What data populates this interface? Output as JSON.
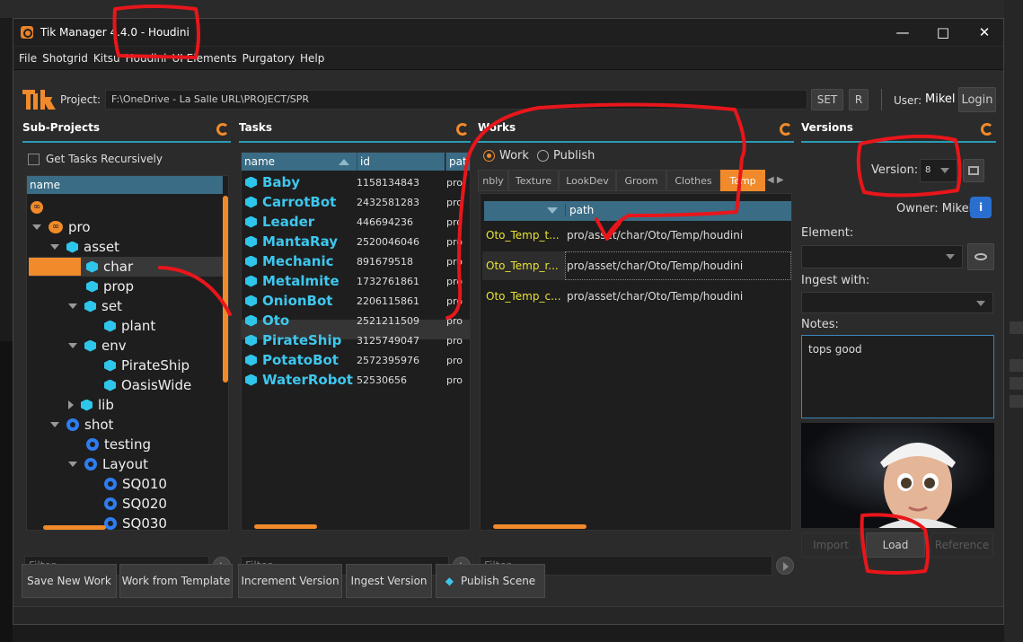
{
  "window": {
    "title": "Tik Manager 4.4.0 - Houdini"
  },
  "menu": [
    "File",
    "Shotgrid",
    "Kitsu",
    "Houdini",
    "UI Elements",
    "Purgatory",
    "Help"
  ],
  "header": {
    "project_label": "Project:",
    "project_path": "F:\\OneDrive - La Salle URL\\PROJECT/SPR",
    "set_label": "SET",
    "r_label": "R",
    "user_label": "User:",
    "user_name": "Mikel",
    "login_label": "Login"
  },
  "subprojects": {
    "title": "Sub-Projects",
    "recursive_label": "Get Tasks Recursively",
    "col_name": "name",
    "filter_placeholder": "Filter",
    "tree": [
      {
        "label": "pro",
        "icon": "infinity"
      },
      {
        "label": "asset",
        "icon": "cube"
      },
      {
        "label": "char",
        "icon": "cube"
      },
      {
        "label": "prop",
        "icon": "cube"
      },
      {
        "label": "set",
        "icon": "cube"
      },
      {
        "label": "plant",
        "icon": "cube"
      },
      {
        "label": "env",
        "icon": "cube"
      },
      {
        "label": "PirateShip",
        "icon": "cube"
      },
      {
        "label": "OasisWide",
        "icon": "cube"
      },
      {
        "label": "lib",
        "icon": "cube"
      },
      {
        "label": "shot",
        "icon": "reel"
      },
      {
        "label": "testing",
        "icon": "reel"
      },
      {
        "label": "Layout",
        "icon": "reel"
      },
      {
        "label": "SQ010",
        "icon": "reel"
      },
      {
        "label": "SQ020",
        "icon": "reel"
      },
      {
        "label": "SQ030",
        "icon": "reel"
      }
    ]
  },
  "tasks": {
    "title": "Tasks",
    "cols": [
      "name",
      "id",
      "pat"
    ],
    "filter_placeholder": "Filter",
    "rows": [
      {
        "name": "Baby",
        "id": "1158134843",
        "path": "pro"
      },
      {
        "name": "CarrotBot",
        "id": "2432581283",
        "path": "pro"
      },
      {
        "name": "Leader",
        "id": "446694236",
        "path": "pro"
      },
      {
        "name": "MantaRay",
        "id": "2520046046",
        "path": "pro"
      },
      {
        "name": "Mechanic",
        "id": "891679518",
        "path": "pro"
      },
      {
        "name": "Metalmite",
        "id": "1732761861",
        "path": "pro"
      },
      {
        "name": "OnionBot",
        "id": "2206115861",
        "path": "pro"
      },
      {
        "name": "Oto",
        "id": "2521211509",
        "path": "pro"
      },
      {
        "name": "PirateShip",
        "id": "3125749047",
        "path": "pro"
      },
      {
        "name": "PotatoBot",
        "id": "2572395976",
        "path": "pro"
      },
      {
        "name": "WaterRobot",
        "id": "52530656",
        "path": "pro"
      }
    ]
  },
  "works": {
    "title": "Works",
    "work_label": "Work",
    "publish_label": "Publish",
    "tabs": [
      "nbly",
      "Texture",
      "LookDev",
      "Groom",
      "Clothes",
      "Temp"
    ],
    "col_path": "path",
    "filter_placeholder": "Filter",
    "rows": [
      {
        "name": "Oto_Temp_t...",
        "path": "pro/asset/char/Oto/Temp/houdini"
      },
      {
        "name": "Oto_Temp_r...",
        "path": "pro/asset/char/Oto/Temp/houdini"
      },
      {
        "name": "Oto_Temp_c...",
        "path": "pro/asset/char/Oto/Temp/houdini"
      }
    ]
  },
  "versions": {
    "title": "Versions",
    "version_label": "Version:",
    "version_value": "8",
    "owner_label": "Owner: Mikel",
    "element_label": "Element:",
    "ingest_label": "Ingest with:",
    "notes_label": "Notes:",
    "notes_text": "tops good",
    "import_label": "Import",
    "load_label": "Load",
    "reference_label": "Reference"
  },
  "actions": {
    "save_new_work": "Save New Work",
    "work_from_template": "Work from Template",
    "increment_version": "Increment Version",
    "ingest_version": "Ingest Version",
    "publish_scene": "Publish Scene"
  },
  "colors": {
    "accent": "#f08a2a",
    "task_text": "#3ec7ee",
    "work_name": "#e8e335",
    "header_blue": "#3a6c85",
    "annotation": "#e8161b"
  }
}
